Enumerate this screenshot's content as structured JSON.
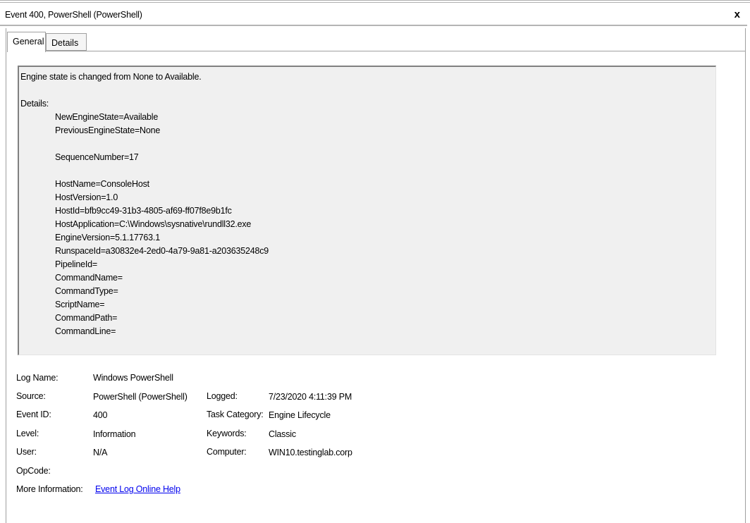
{
  "window": {
    "title": "Event 400, PowerShell (PowerShell)",
    "close_label": "x"
  },
  "tabs": [
    {
      "label": "General",
      "active": true
    },
    {
      "label": "Details",
      "active": false
    }
  ],
  "message": {
    "summary": "Engine state is changed from None to Available.",
    "details_label": "Details:",
    "lines": [
      "NewEngineState=Available",
      "PreviousEngineState=None",
      "SequenceNumber=17",
      "HostName=ConsoleHost",
      "HostVersion=1.0",
      "HostId=bfb9cc49-31b3-4805-af69-ff07f8e9b1fc",
      "HostApplication=C:\\Windows\\sysnative\\rundll32.exe",
      "EngineVersion=5.1.17763.1",
      "RunspaceId=a30832e4-2ed0-4a79-9a81-a203635248c9",
      "PipelineId=",
      "CommandName=",
      "CommandType=",
      "ScriptName=",
      "CommandPath=",
      "CommandLine="
    ]
  },
  "properties": {
    "log_name": {
      "label": "Log Name:",
      "value": "Windows PowerShell"
    },
    "source": {
      "label": "Source:",
      "value": "PowerShell (PowerShell)"
    },
    "logged": {
      "label": "Logged:",
      "value": "7/23/2020 4:11:39 PM"
    },
    "event_id": {
      "label": "Event ID:",
      "value": "400"
    },
    "task_category": {
      "label": "Task Category:",
      "value": "Engine Lifecycle"
    },
    "level": {
      "label": "Level:",
      "value": "Information"
    },
    "keywords": {
      "label": "Keywords:",
      "value": "Classic"
    },
    "user": {
      "label": "User:",
      "value": "N/A"
    },
    "computer": {
      "label": "Computer:",
      "value": "WIN10.testinglab.corp"
    },
    "opcode": {
      "label": "OpCode:",
      "value": ""
    },
    "more_info": {
      "label": "More Information:",
      "link": "Event Log Online Help"
    }
  }
}
